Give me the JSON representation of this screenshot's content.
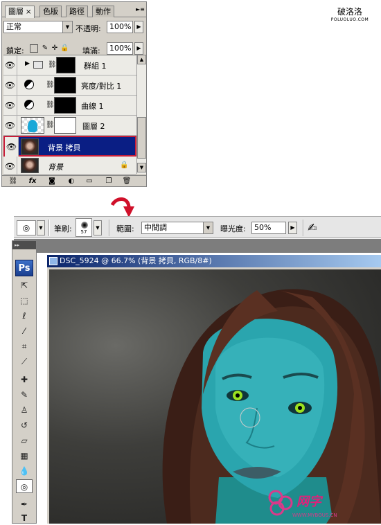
{
  "watermark": {
    "site_name": "破洛洛",
    "site_url": "POLUOLUO.COM"
  },
  "layers_panel": {
    "tabs": [
      {
        "label": "圖層",
        "active": true,
        "close": "×"
      },
      {
        "label": "色版",
        "active": false
      },
      {
        "label": "路徑",
        "active": false
      },
      {
        "label": "動作",
        "active": false
      }
    ],
    "menu_icon": "►≡",
    "blend_mode": "正常",
    "opacity_label": "不透明:",
    "opacity_value": "100%",
    "lock_label": "鎖定:",
    "fill_label": "填滿:",
    "fill_value": "100%",
    "layers": [
      {
        "name": "群組 1",
        "type": "group",
        "visible": true,
        "selected": false
      },
      {
        "name": "亮度/對比 1",
        "type": "adjustment",
        "visible": true,
        "selected": false
      },
      {
        "name": "曲線 1",
        "type": "adjustment",
        "visible": true,
        "selected": false
      },
      {
        "name": "圖層 2",
        "type": "pixel-mask",
        "visible": true,
        "selected": false
      },
      {
        "name": "背景 拷貝",
        "type": "photo",
        "visible": true,
        "selected": true
      },
      {
        "name": "背景",
        "type": "background",
        "visible": true,
        "selected": false,
        "locked": true
      }
    ],
    "bottom_icons": [
      "link-icon",
      "fx-icon",
      "mask-icon",
      "adjustment-icon",
      "folder-icon",
      "new-layer-icon",
      "trash-icon"
    ]
  },
  "options_bar": {
    "brush_label": "筆刷:",
    "brush_size": "57",
    "range_label": "範圍:",
    "range_value": "中間調",
    "exposure_label": "曝光度:",
    "exposure_value": "50%"
  },
  "toolbox": {
    "header": "▸▸",
    "logo": "Ps",
    "tools": [
      "move-icon",
      "marquee-icon",
      "lasso-icon",
      "magic-wand-icon",
      "crop-icon",
      "slice-icon",
      "healing-icon",
      "brush-icon",
      "stamp-icon",
      "history-brush-icon",
      "eraser-icon",
      "gradient-icon",
      "blur-icon",
      "dodge-icon",
      "pen-icon",
      "type-icon"
    ],
    "active_tool": "dodge-icon"
  },
  "document": {
    "title": "DSC_5924 @ 66.7% (背景 拷貝, RGB/8#)"
  },
  "corner_logo": {
    "text": "网字",
    "url": "WWW.MYBOUS.CN"
  },
  "colors": {
    "selection_bg": "#0a1e84",
    "selection_border": "#c81e3a",
    "arrow": "#d0102a",
    "title_bar": "#0a246a"
  }
}
